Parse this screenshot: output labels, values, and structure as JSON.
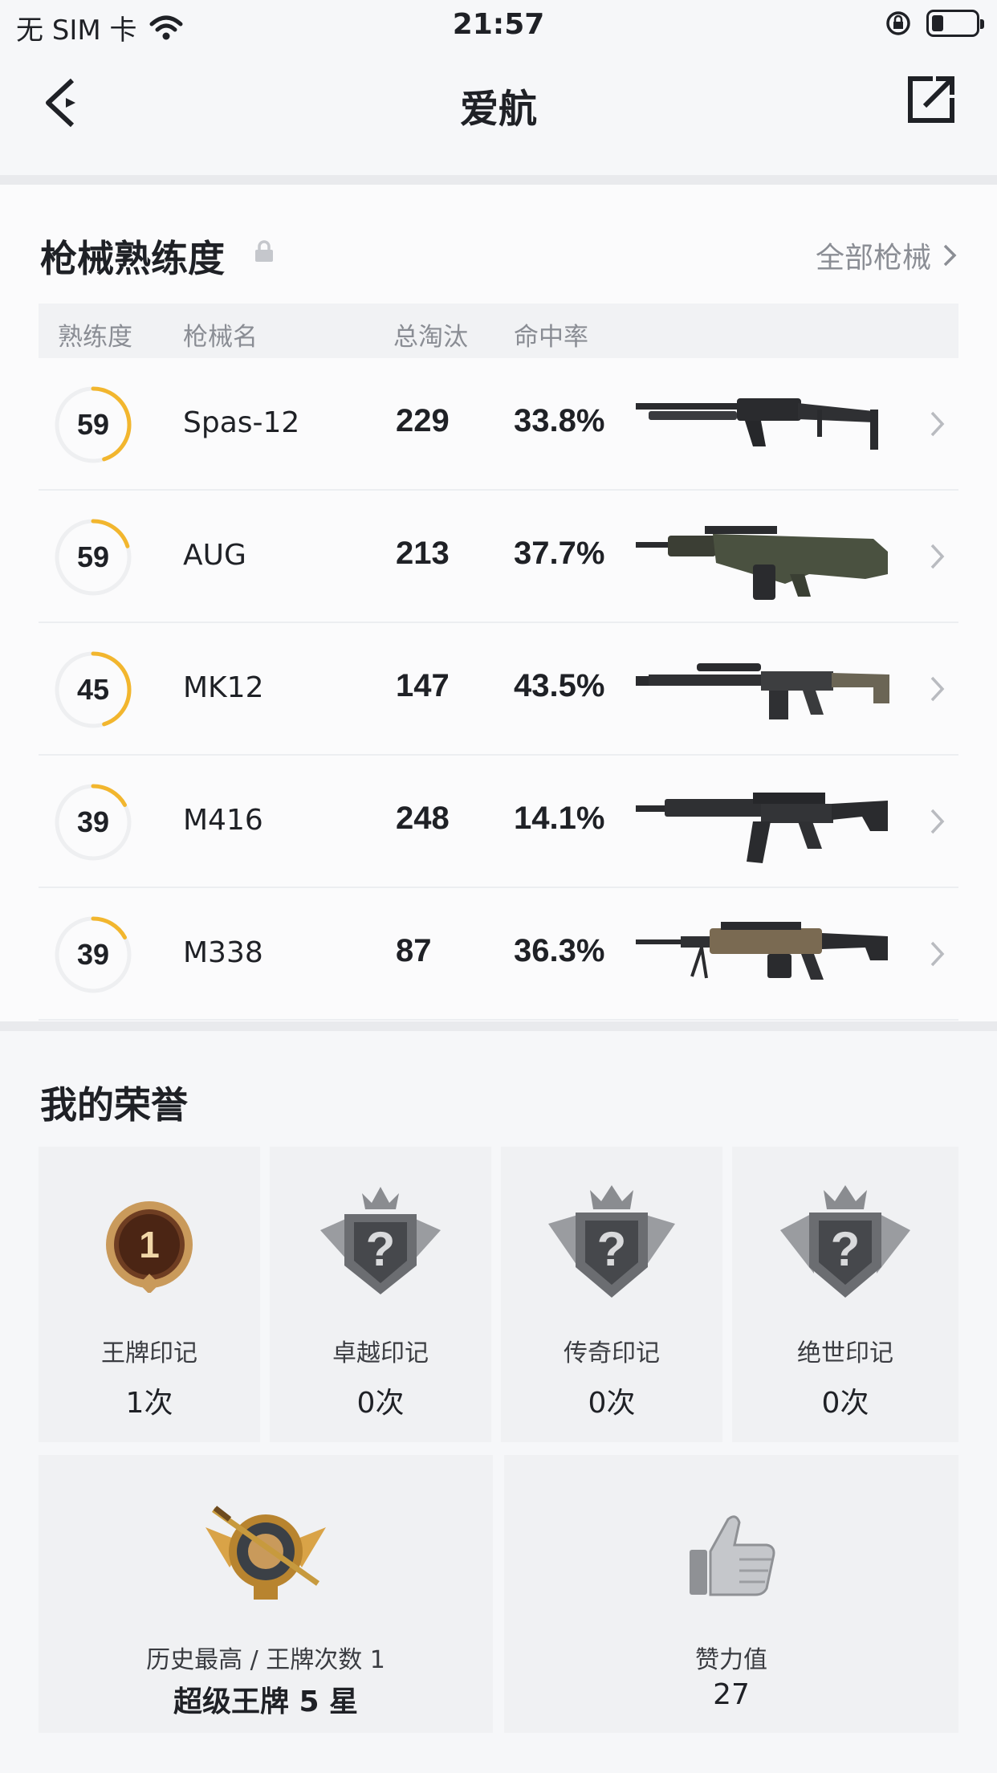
{
  "status_bar": {
    "carrier": "无 SIM 卡",
    "time": "21:57"
  },
  "nav": {
    "title": "爱航"
  },
  "weapons": {
    "title": "枪械熟练度",
    "all_link": "全部枪械",
    "headers": {
      "mastery": "熟练度",
      "name": "枪械名",
      "kills": "总淘汰",
      "accuracy": "命中率"
    },
    "rows": [
      {
        "mastery": "59",
        "mastery_progress": 0.45,
        "name": "Spas-12",
        "kills": "229",
        "accuracy": "33.8%",
        "icon": "shotgun-icon"
      },
      {
        "mastery": "59",
        "mastery_progress": 0.2,
        "name": "AUG",
        "kills": "213",
        "accuracy": "37.7%",
        "icon": "bullpup-rifle-icon"
      },
      {
        "mastery": "45",
        "mastery_progress": 0.45,
        "name": "MK12",
        "kills": "147",
        "accuracy": "43.5%",
        "icon": "marksman-rifle-icon"
      },
      {
        "mastery": "39",
        "mastery_progress": 0.17,
        "name": "M416",
        "kills": "248",
        "accuracy": "14.1%",
        "icon": "assault-rifle-icon"
      },
      {
        "mastery": "39",
        "mastery_progress": 0.17,
        "name": "M338",
        "kills": "87",
        "accuracy": "36.3%",
        "icon": "machine-gun-icon"
      }
    ],
    "ring_color": "#f2b62e",
    "ring_track_color": "#eeeff1"
  },
  "honors": {
    "title": "我的荣誉",
    "badges": [
      {
        "label": "王牌印记",
        "value": "1次",
        "icon": "ace-badge-icon",
        "badge_number": "1"
      },
      {
        "label": "卓越印记",
        "value": "0次",
        "icon": "locked-badge-icon",
        "badge_number": "?"
      },
      {
        "label": "传奇印记",
        "value": "0次",
        "icon": "locked-badge-icon",
        "badge_number": "?"
      },
      {
        "label": "绝世印记",
        "value": "0次",
        "icon": "locked-badge-icon",
        "badge_number": "?"
      }
    ],
    "best_rank": {
      "label": "历史最高 / 王牌次数 1",
      "value": "超级王牌 5 星",
      "icon": "rank-emblem-icon"
    },
    "likes": {
      "label": "赞力值",
      "value": "27",
      "icon": "thumbs-up-icon"
    }
  }
}
